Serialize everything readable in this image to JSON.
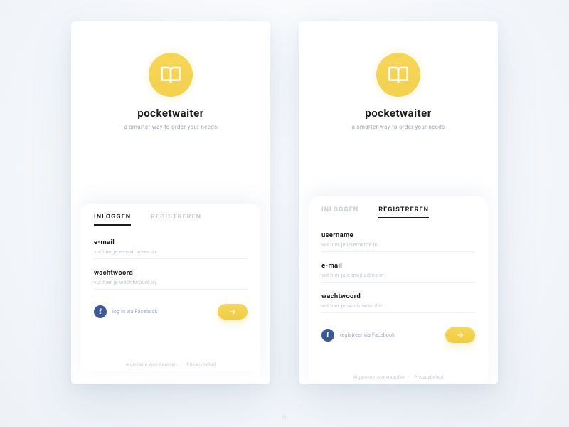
{
  "brand": {
    "name": "pocketwaiter",
    "tagline": "a smarter way to order your needs"
  },
  "tabs": {
    "login": "INLOGGEN",
    "register": "REGISTREREN"
  },
  "fields": {
    "username": {
      "label": "username",
      "placeholder": "vul hier je username in"
    },
    "email": {
      "label": "e-mail",
      "placeholder": "vul hier je e-mail adres in"
    },
    "password": {
      "label": "wachtwoord",
      "placeholder": "vul hier je wachtwoord in"
    }
  },
  "fb": {
    "login": "log in via Facebook",
    "register": "registreer via Facebook"
  },
  "legal": {
    "terms": "Algemene voorwaarden",
    "privacy": "Privacybeleid",
    "sep": "·"
  },
  "watermark": "n"
}
